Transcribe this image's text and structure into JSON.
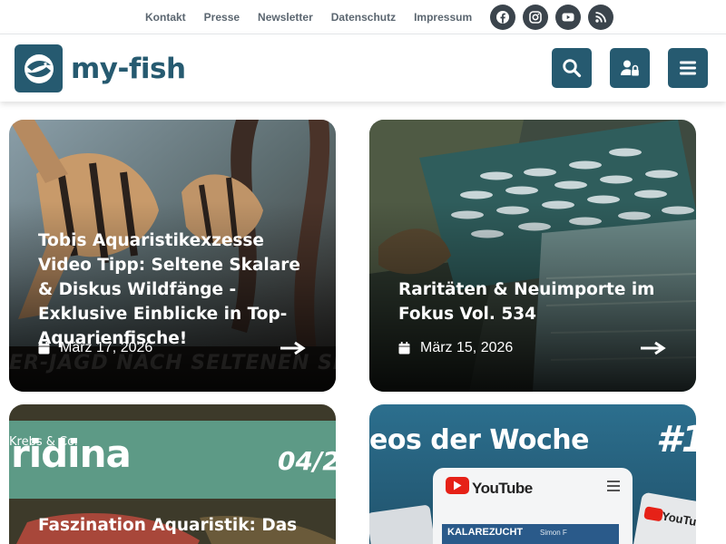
{
  "topnav": {
    "links": [
      "Kontakt",
      "Presse",
      "Newsletter",
      "Datenschutz",
      "Impressum"
    ]
  },
  "social_icons": [
    "facebook-icon",
    "instagram-icon",
    "youtube-icon",
    "rss-icon"
  ],
  "logo": {
    "text": "my-fish"
  },
  "header_buttons": [
    "search-icon",
    "user-lock-icon",
    "menu-icon"
  ],
  "colors": {
    "brand": "#265a70",
    "social": "#3b444c",
    "nav_text": "#5b6670"
  },
  "cards": [
    {
      "title": "Tobis Aquaristikexzesse Video Tipp: Seltene Skalare & Diskus Wildfänge - Exklusive Einblicke in Top-Aquarienfische!",
      "date": "März 17, 2026",
      "overlay": "ER-JAGD NACH SELTENEN SKA"
    },
    {
      "title": "Raritäten & Neuimporte im Fokus Vol. 534",
      "date": "März 15, 2026"
    },
    {
      "title": "Faszination Aquaristik: Das",
      "banner_small": "Krebs & Co.",
      "banner_big": "ridina",
      "banner_issue": "04/2"
    },
    {
      "banner_title": "eos der Woche",
      "banner_number": "#1",
      "youtube_label": "YouTube",
      "thumb_label": "KALAREZUCHT",
      "thumb_sub": "Simon F"
    }
  ]
}
